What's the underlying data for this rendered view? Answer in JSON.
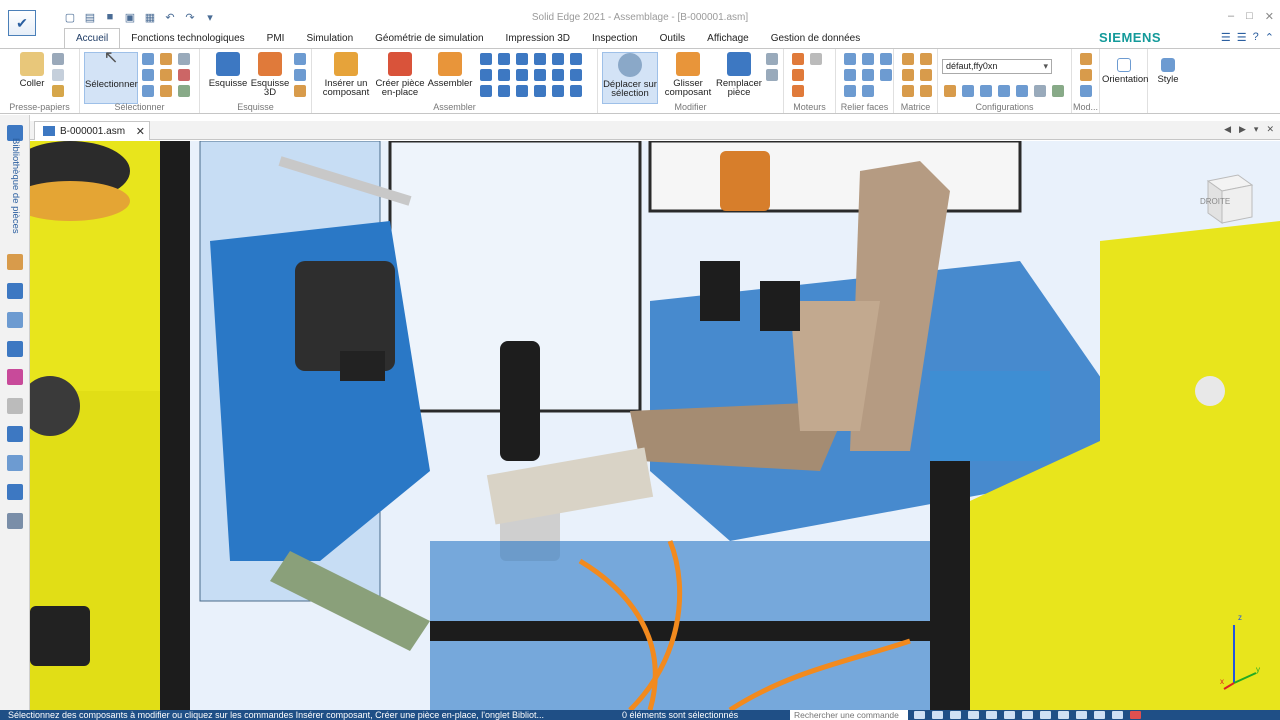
{
  "window": {
    "title": "Solid Edge 2021 - Assemblage - [B-000001.asm]",
    "brand": "SIEMENS"
  },
  "tabs": [
    {
      "label": "Accueil",
      "active": true
    },
    {
      "label": "Fonctions technologiques"
    },
    {
      "label": "PMI"
    },
    {
      "label": "Simulation"
    },
    {
      "label": "Géométrie de simulation"
    },
    {
      "label": "Impression 3D"
    },
    {
      "label": "Inspection"
    },
    {
      "label": "Outils"
    },
    {
      "label": "Affichage"
    },
    {
      "label": "Gestion de données"
    }
  ],
  "ribbon": {
    "coller": "Coller",
    "presse_papiers": "Presse-papiers",
    "selectionner": "Sélectionner",
    "selectionner_group": "Sélectionner",
    "esquisse": "Esquisse",
    "esquisse_3d": "Esquisse 3D",
    "esquisse_group": "Esquisse",
    "inserer_composant": "Insérer un composant",
    "creer_piece": "Créer pièce en-place",
    "assembler": "Assembler",
    "assembler_group": "Assembler",
    "deplacer_selection": "Déplacer sur sélection",
    "glisser_composant": "Glisser composant",
    "remplacer_piece": "Remplacer pièce",
    "modifier_group": "Modifier",
    "moteurs_group": "Moteurs",
    "relier_faces_group": "Relier faces",
    "matrice_group": "Matrice",
    "config_value": "défaut,ffy0xn",
    "configurations_group": "Configurations",
    "mod_group": "Mod...",
    "orientation": "Orientation",
    "style": "Style"
  },
  "sidebar": {
    "library_label": "Bibliothèque de pièces"
  },
  "document": {
    "tab_label": "B-000001.asm"
  },
  "viewport": {
    "view_cube_label": "DROITE",
    "triad_x": "x",
    "triad_y": "y",
    "triad_z": "z"
  },
  "status": {
    "message": "Sélectionnez des composants à modifier ou cliquez sur les commandes Insérer composant, Créer une pièce en-place, l'onglet Bibliot...",
    "selection_count": "0 éléments sont sélectionnés",
    "search_placeholder": "Rechercher une commande"
  },
  "colors": {
    "accent": "#1f4f86",
    "brand": "#139a9a",
    "cab_yellow": "#e8e51c",
    "cab_blue": "#2a78c6",
    "wire_orange": "#f28a1e",
    "seat_tan": "#b59b82"
  }
}
